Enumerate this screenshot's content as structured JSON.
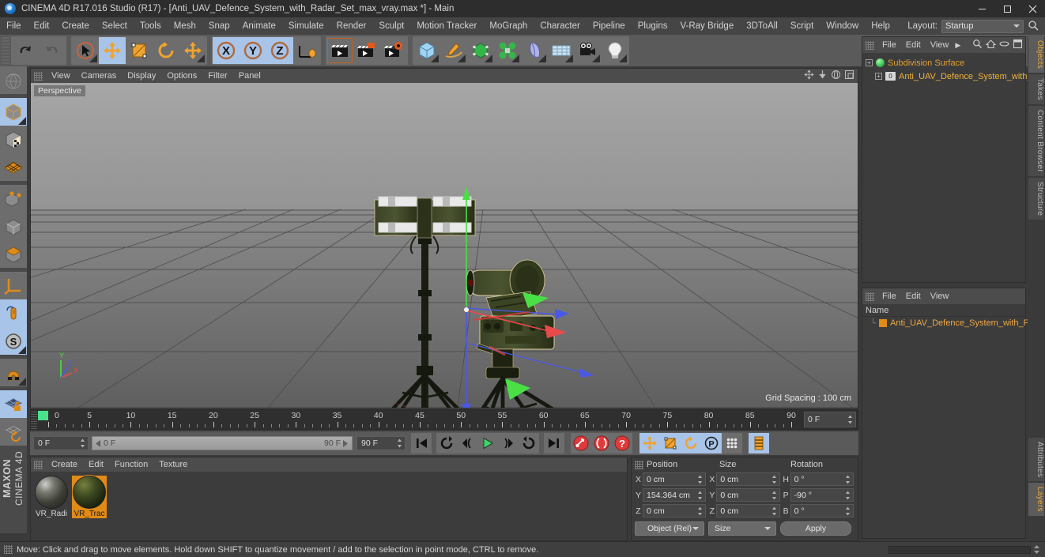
{
  "window": {
    "title": "CINEMA 4D R17.016 Studio (R17) - [Anti_UAV_Defence_System_with_Radar_Set_max_vray.max *] - Main",
    "logo_icon": "c4d-logo-icon",
    "minimize_icon": "minimize-icon",
    "maximize_icon": "maximize-icon",
    "close_icon": "close-icon"
  },
  "menubar": {
    "items": [
      "File",
      "Edit",
      "Create",
      "Select",
      "Tools",
      "Mesh",
      "Snap",
      "Animate",
      "Simulate",
      "Render",
      "Sculpt",
      "Motion Tracker",
      "MoGraph",
      "Character",
      "Pipeline",
      "Plugins",
      "V-Ray Bridge",
      "3DToAll",
      "Script",
      "Window",
      "Help"
    ],
    "layout_label": "Layout:",
    "layout_value": "Startup",
    "search_icon": "search-icon"
  },
  "toolbar": {
    "groups": [
      {
        "buttons": [
          {
            "name": "undo-button",
            "icon": "undo-arrow-icon",
            "active": false
          },
          {
            "name": "redo-button",
            "icon": "redo-arrow-icon",
            "active": false
          }
        ]
      },
      {
        "buttons": [
          {
            "name": "live-selection-tool",
            "icon": "cursor-circle-icon",
            "active": false
          },
          {
            "name": "move-tool",
            "icon": "move-cross-icon",
            "active": true
          },
          {
            "name": "scale-tool",
            "icon": "scale-square-icon",
            "active": false
          },
          {
            "name": "rotate-tool",
            "icon": "rotate-circle-icon",
            "active": false
          },
          {
            "name": "transform-tool",
            "icon": "move-cross-icon",
            "active": false
          }
        ]
      },
      {
        "buttons": [
          {
            "name": "axis-x-lock",
            "icon": "axis-x-icon",
            "active": true
          },
          {
            "name": "axis-y-lock",
            "icon": "axis-y-icon",
            "active": true
          },
          {
            "name": "axis-z-lock",
            "icon": "axis-z-icon",
            "active": true
          },
          {
            "name": "world-object-coord-toggle",
            "icon": "world-coordinate-icon",
            "active": false
          }
        ]
      },
      {
        "buttons": [
          {
            "name": "render-view-button",
            "icon": "render-clapper-icon",
            "active": false
          },
          {
            "name": "render-region-button",
            "icon": "render-region-clapper-icon",
            "active": false
          },
          {
            "name": "render-settings-button",
            "icon": "render-settings-clapper-icon",
            "active": false
          }
        ]
      },
      {
        "buttons": [
          {
            "name": "add-cube-button",
            "icon": "cube-icon",
            "active": false
          },
          {
            "name": "add-spline-button",
            "icon": "pen-spline-icon",
            "active": false
          },
          {
            "name": "add-generator-button",
            "icon": "green-subdivision-cube-icon",
            "active": false
          },
          {
            "name": "add-mograph-button",
            "icon": "green-cloner-icon",
            "active": false
          },
          {
            "name": "add-deformer-button",
            "icon": "bend-deformer-icon",
            "active": false
          },
          {
            "name": "add-environment-button",
            "icon": "floor-grid-icon",
            "active": false
          },
          {
            "name": "add-camera-button",
            "icon": "camera-icon",
            "active": false
          },
          {
            "name": "add-light-button",
            "icon": "light-bulb-icon",
            "active": false
          }
        ]
      }
    ]
  },
  "leftbar": {
    "groups": [
      {
        "buttons": [
          {
            "name": "make-editable-button",
            "icon": "make-editable-icon",
            "active": false
          }
        ]
      },
      {
        "buttons": [
          {
            "name": "model-mode-button",
            "icon": "model-cube-icon",
            "active": true
          },
          {
            "name": "texture-mode-button",
            "icon": "texture-cube-icon",
            "active": false
          },
          {
            "name": "workplane-mode-button",
            "icon": "workplane-grid-icon",
            "active": false
          }
        ]
      },
      {
        "buttons": [
          {
            "name": "point-mode-button",
            "icon": "point-cube-icon",
            "active": false
          },
          {
            "name": "edge-mode-button",
            "icon": "edge-cube-icon",
            "active": false
          },
          {
            "name": "polygon-mode-button",
            "icon": "polygon-cube-icon",
            "active": false
          }
        ]
      },
      {
        "buttons": [
          {
            "name": "object-axis-mode-button",
            "icon": "axis-corner-icon",
            "active": false
          },
          {
            "name": "enable-axis-button",
            "icon": "mouse-axis-icon",
            "active": true
          },
          {
            "name": "soft-selection-button",
            "icon": "s-circle-icon",
            "active": true
          }
        ]
      },
      {
        "buttons": [
          {
            "name": "snap-magnet-button",
            "icon": "magnet-icon",
            "active": false
          }
        ]
      },
      {
        "buttons": [
          {
            "name": "lock-workplane-button",
            "icon": "grid-lock-icon",
            "active": true
          },
          {
            "name": "planar-workplane-button",
            "icon": "grid-rotate-icon",
            "active": false
          }
        ]
      }
    ],
    "brand_top": "MAXON",
    "brand_bottom": "CINEMA 4D"
  },
  "viewport": {
    "menus": [
      "View",
      "Cameras",
      "Display",
      "Options",
      "Filter",
      "Panel"
    ],
    "view_label": "Perspective",
    "grid_spacing": "Grid Spacing : 100 cm",
    "header_icons": [
      "pan-icon",
      "dolly-icon",
      "orbit-icon",
      "maximize-view-icon"
    ],
    "axis_labels": {
      "y": "Y",
      "z": "Z",
      "x": "X"
    },
    "scene_objects": [
      "radar-mast-model",
      "anti-uav-gun-model"
    ]
  },
  "timeline": {
    "ruler_min": 0,
    "ruler_max": 90,
    "major_step": 5,
    "labels": [
      0,
      5,
      10,
      15,
      20,
      25,
      30,
      35,
      40,
      45,
      50,
      55,
      60,
      65,
      70,
      75,
      80,
      85,
      90
    ],
    "current_frame_field": "0 F",
    "marker_frame": 0
  },
  "transport": {
    "current_frame": "0 F",
    "range_start": "0 F",
    "range_end": "90 F",
    "end_frame": "90 F",
    "buttons": [
      {
        "name": "go-to-start-button",
        "icon": "skip-start-icon",
        "active": false
      },
      {
        "name": "play-reverse-loop-button",
        "icon": "loop-reverse-icon",
        "active": false
      },
      {
        "name": "previous-key-button",
        "icon": "previous-key-icon",
        "active": false
      },
      {
        "name": "play-button",
        "icon": "play-icon",
        "active": false
      },
      {
        "name": "next-key-button",
        "icon": "next-key-icon",
        "active": false
      },
      {
        "name": "play-forward-loop-button",
        "icon": "loop-forward-icon",
        "active": false
      },
      {
        "name": "go-to-end-button",
        "icon": "skip-end-icon",
        "active": false
      },
      {
        "name": "record-active-objects-button",
        "icon": "record-key-icon",
        "active": false
      },
      {
        "name": "autokeying-button",
        "icon": "autokey-icon",
        "active": false
      },
      {
        "name": "keyframe-selection-button",
        "icon": "question-key-icon",
        "active": false
      },
      {
        "name": "position-key-button",
        "icon": "position-key-icon",
        "active": true
      },
      {
        "name": "scale-key-button",
        "icon": "scale-key-icon",
        "active": true
      },
      {
        "name": "rotation-key-button",
        "icon": "rotation-key-icon",
        "active": true
      },
      {
        "name": "pla-key-button",
        "icon": "pla-key-icon",
        "active": true
      },
      {
        "name": "param-key-button",
        "icon": "parameter-dots-icon",
        "active": false
      },
      {
        "name": "timeline-layout-button",
        "icon": "timeline-bars-icon",
        "active": true
      }
    ]
  },
  "material_manager": {
    "menus": [
      "Create",
      "Edit",
      "Function",
      "Texture"
    ],
    "materials": [
      {
        "name": "VR_Radi",
        "preview": "radar",
        "selected": false
      },
      {
        "name": "VR_Trac",
        "preview": "track",
        "selected": true
      }
    ]
  },
  "coordinates": {
    "columns": [
      "Position",
      "Size",
      "Rotation"
    ],
    "rows": [
      {
        "pos_axis": "X",
        "pos_value": "0 cm",
        "size_axis": "X",
        "size_value": "0 cm",
        "rot_axis": "H",
        "rot_value": "0 °"
      },
      {
        "pos_axis": "Y",
        "pos_value": "154.364 cm",
        "size_axis": "Y",
        "size_value": "0 cm",
        "rot_axis": "P",
        "rot_value": "-90 °"
      },
      {
        "pos_axis": "Z",
        "pos_value": "0 cm",
        "size_axis": "Z",
        "size_value": "0 cm",
        "rot_axis": "B",
        "rot_value": "0 °"
      }
    ],
    "mode_dropdown": "Object (Rel)",
    "size_dropdown": "Size",
    "apply_button": "Apply"
  },
  "object_manager": {
    "menus": [
      "File",
      "Edit",
      "View"
    ],
    "overflow_icon": "chevron-right-icon",
    "icons": [
      "search-icon",
      "home-icon",
      "link-icon",
      "layer-icon"
    ],
    "tree": [
      {
        "label": "Subdivision Surface",
        "icon": "subdivision-surface-icon",
        "depth": 0,
        "color": "orange"
      },
      {
        "label": "Anti_UAV_Defence_System_with_",
        "icon": "null-object-icon",
        "depth": 1,
        "color": "amber",
        "level_badge": "0"
      }
    ]
  },
  "attribute_manager": {
    "menus": [
      "File",
      "Edit",
      "View"
    ],
    "column_header": "Name",
    "rows": [
      {
        "label": "Anti_UAV_Defence_System_with_F",
        "tag_icon": "material-tag-icon"
      }
    ]
  },
  "tabstrip": {
    "top_tabs": [
      {
        "label": "Objects",
        "active": true
      },
      {
        "label": "Takes",
        "active": false
      },
      {
        "label": "Content Browser",
        "active": false
      },
      {
        "label": "Structure",
        "active": false
      }
    ],
    "bottom_tabs": [
      {
        "label": "Attributes",
        "active": false
      },
      {
        "label": "Layers",
        "active": true
      }
    ]
  },
  "statusbar": {
    "message": "Move: Click and drag to move elements. Hold down SHIFT to quantize movement / add to the selection in point mode, CTRL to remove.",
    "grip_icon": "grip-icon"
  },
  "colors": {
    "accent_orange": "#e08a18",
    "axis_x_red": "#e03232",
    "axis_y_green": "#3fe03f",
    "axis_z_blue": "#4050e0",
    "selected_highlight": "#a8c4e8",
    "panel_bg": "#3c3c3c",
    "toolbar_bg": "#5a5a5a"
  }
}
